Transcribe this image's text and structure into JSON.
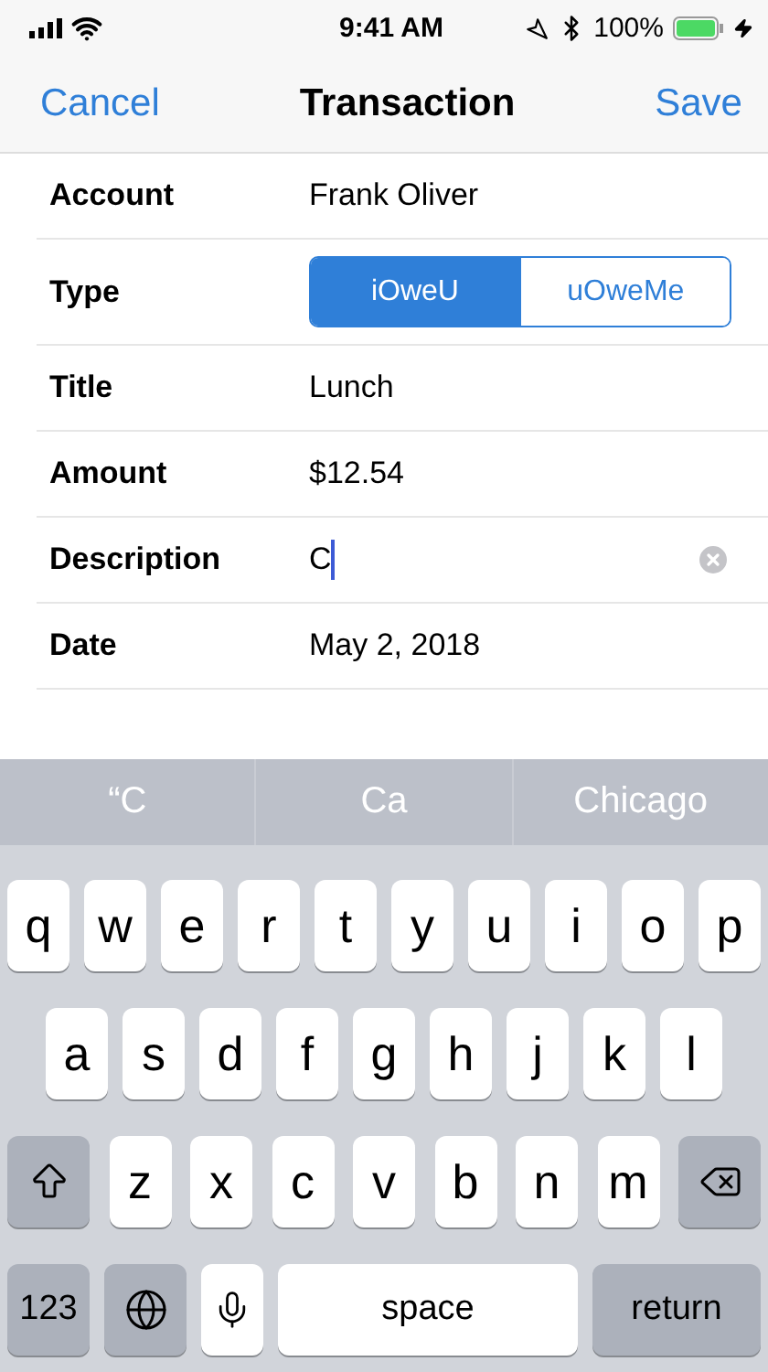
{
  "status_bar": {
    "time": "9:41 AM",
    "battery": "100%"
  },
  "nav": {
    "left": "Cancel",
    "title": "Transaction",
    "right": "Save"
  },
  "form": [
    {
      "kind": "text",
      "label": "Account",
      "value": "Frank Oliver"
    },
    {
      "kind": "segmented",
      "label": "Type",
      "options": [
        {
          "label": "iOweU",
          "selected": true
        },
        {
          "label": "uOweMe",
          "selected": false
        }
      ]
    },
    {
      "kind": "text",
      "label": "Title",
      "value": "Lunch"
    },
    {
      "kind": "text",
      "label": "Amount",
      "value": "$12.54"
    },
    {
      "kind": "input",
      "label": "Description",
      "value": "C",
      "focused": true
    },
    {
      "kind": "text",
      "label": "Date",
      "value": "May 2, 2018"
    }
  ],
  "suggestions": [
    "“C",
    "Ca",
    "Chicago"
  ],
  "keyboard": [
    [
      {
        "kind": "letter",
        "label": "q"
      },
      {
        "kind": "letter",
        "label": "w"
      },
      {
        "kind": "letter",
        "label": "e"
      },
      {
        "kind": "letter",
        "label": "r"
      },
      {
        "kind": "letter",
        "label": "t"
      },
      {
        "kind": "letter",
        "label": "y"
      },
      {
        "kind": "letter",
        "label": "u"
      },
      {
        "kind": "letter",
        "label": "i"
      },
      {
        "kind": "letter",
        "label": "o"
      },
      {
        "kind": "letter",
        "label": "p"
      }
    ],
    [
      {
        "kind": "letter",
        "label": "a"
      },
      {
        "kind": "letter",
        "label": "s"
      },
      {
        "kind": "letter",
        "label": "d"
      },
      {
        "kind": "letter",
        "label": "f"
      },
      {
        "kind": "letter",
        "label": "g"
      },
      {
        "kind": "letter",
        "label": "h"
      },
      {
        "kind": "letter",
        "label": "j"
      },
      {
        "kind": "letter",
        "label": "k"
      },
      {
        "kind": "letter",
        "label": "l"
      }
    ],
    [
      {
        "kind": "shift"
      },
      {
        "kind": "letter",
        "label": "z"
      },
      {
        "kind": "letter",
        "label": "x"
      },
      {
        "kind": "letter",
        "label": "c"
      },
      {
        "kind": "letter",
        "label": "v"
      },
      {
        "kind": "letter",
        "label": "b"
      },
      {
        "kind": "letter",
        "label": "n"
      },
      {
        "kind": "letter",
        "label": "m"
      },
      {
        "kind": "delete"
      }
    ],
    [
      {
        "kind": "numbers",
        "label": "123"
      },
      {
        "kind": "globe"
      },
      {
        "kind": "mic"
      },
      {
        "kind": "space",
        "label": "space"
      },
      {
        "kind": "return",
        "label": "return"
      }
    ]
  ]
}
